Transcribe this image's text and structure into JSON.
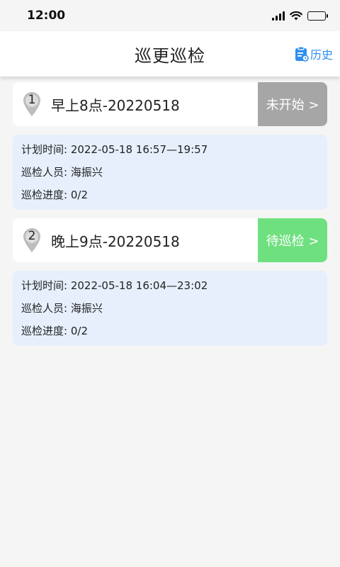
{
  "status_bar": {
    "time": "12:00"
  },
  "header": {
    "title": "巡更巡检",
    "history_label": "历史"
  },
  "colors": {
    "accent": "#2f8ef0",
    "not_started": "#a6a6a6",
    "pending": "#6fe07f",
    "detail_bg": "#e6effb"
  },
  "tasks": [
    {
      "index": "1",
      "name": "早上8点-20220518",
      "status": "未开始 >",
      "status_color": "#a6a6a6",
      "plan_time_label": "计划时间:",
      "plan_time": "2022-05-18 16:57—19:57",
      "inspector_label": "巡检人员:",
      "inspector": "海振兴",
      "progress_label": "巡检进度:",
      "progress": "0/2"
    },
    {
      "index": "2",
      "name": "晚上9点-20220518",
      "status": "待巡检 >",
      "status_color": "#6fe07f",
      "plan_time_label": "计划时间:",
      "plan_time": "2022-05-18 16:04—23:02",
      "inspector_label": "巡检人员:",
      "inspector": "海振兴",
      "progress_label": "巡检进度:",
      "progress": "0/2"
    }
  ]
}
